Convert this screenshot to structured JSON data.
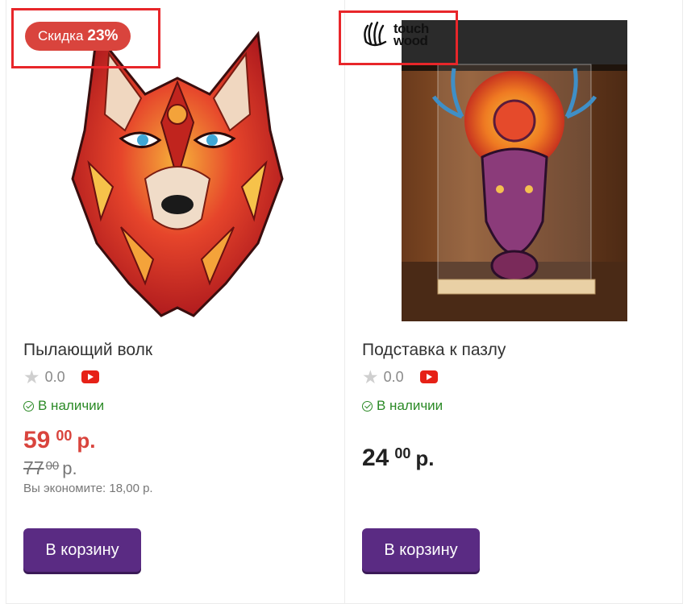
{
  "products": [
    {
      "sale_badge": {
        "prefix": "Скидка",
        "percent": "23%"
      },
      "image_alt": "wolf puzzle",
      "title": "Пылающий волк",
      "rating": "0.0",
      "stock": "В наличии",
      "price": {
        "int": "59",
        "dec": "00",
        "cur": "р."
      },
      "old_price": {
        "int": "77",
        "dec": "00",
        "cur": "р."
      },
      "savings": "Вы экономите: 18,00 р.",
      "cart_label": "В корзину"
    },
    {
      "brand": {
        "line1": "touch",
        "line2": "wood"
      },
      "title": "Подставка к пазлу",
      "rating": "0.0",
      "stock": "В наличии",
      "price": {
        "int": "24",
        "dec": "00",
        "cur": "р."
      },
      "cart_label": "В корзину"
    }
  ],
  "colors": {
    "sale": "#d9443d",
    "accent": "#5a2b83",
    "stock": "#2b8a26",
    "highlight": "#e8262a"
  }
}
